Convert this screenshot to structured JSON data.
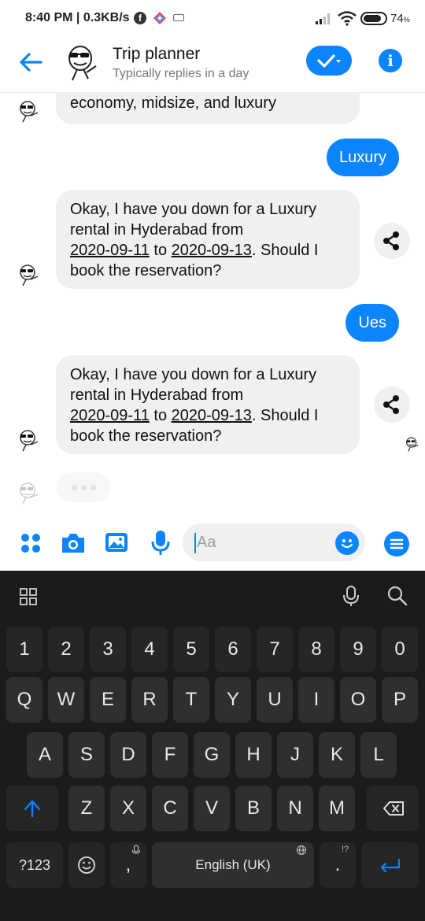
{
  "status_bar": {
    "time": "8:40 PM",
    "speed": "0.3KB/s",
    "battery": "74",
    "battery_unit": "%"
  },
  "header": {
    "title": "Trip planner",
    "subtitle": "Typically replies in a day"
  },
  "messages": [
    {
      "from": "bot",
      "lines": [
        "economy, midsize, and luxury"
      ]
    },
    {
      "from": "user",
      "text": "Luxury"
    },
    {
      "from": "bot",
      "line1": "Okay, I have you down for a Luxury",
      "line2": "rental in Hyderabad from",
      "date_from": "2020-09-11",
      "to_word": " to ",
      "date_to": "2020-09-13",
      "line3_end": ".  Should I",
      "line4": "book the reservation?"
    },
    {
      "from": "user",
      "text": "Ues"
    },
    {
      "from": "bot",
      "line1": "Okay, I have you down for a Luxury",
      "line2": "rental in Hyderabad from",
      "date_from": "2020-09-11",
      "to_word": " to ",
      "date_to": "2020-09-13",
      "line3_end": ".  Should I",
      "line4": "book the reservation?"
    }
  ],
  "composer": {
    "placeholder": "Aa"
  },
  "keyboard": {
    "numbers": [
      "1",
      "2",
      "3",
      "4",
      "5",
      "6",
      "7",
      "8",
      "9",
      "0"
    ],
    "row1": [
      "Q",
      "W",
      "E",
      "R",
      "T",
      "Y",
      "U",
      "I",
      "O",
      "P"
    ],
    "row2": [
      "A",
      "S",
      "D",
      "F",
      "G",
      "H",
      "J",
      "K",
      "L"
    ],
    "row3": [
      "Z",
      "X",
      "C",
      "V",
      "B",
      "N",
      "M"
    ],
    "symbols_label": "?123",
    "comma": ",",
    "space_label": "English (UK)",
    "period": ".",
    "period_hint": "!?"
  },
  "colors": {
    "accent": "#0a84ff",
    "bubble_in": "#f0f0f0",
    "keyboard_bg": "#1b1b1b",
    "key_bg": "#2f2f2f"
  }
}
